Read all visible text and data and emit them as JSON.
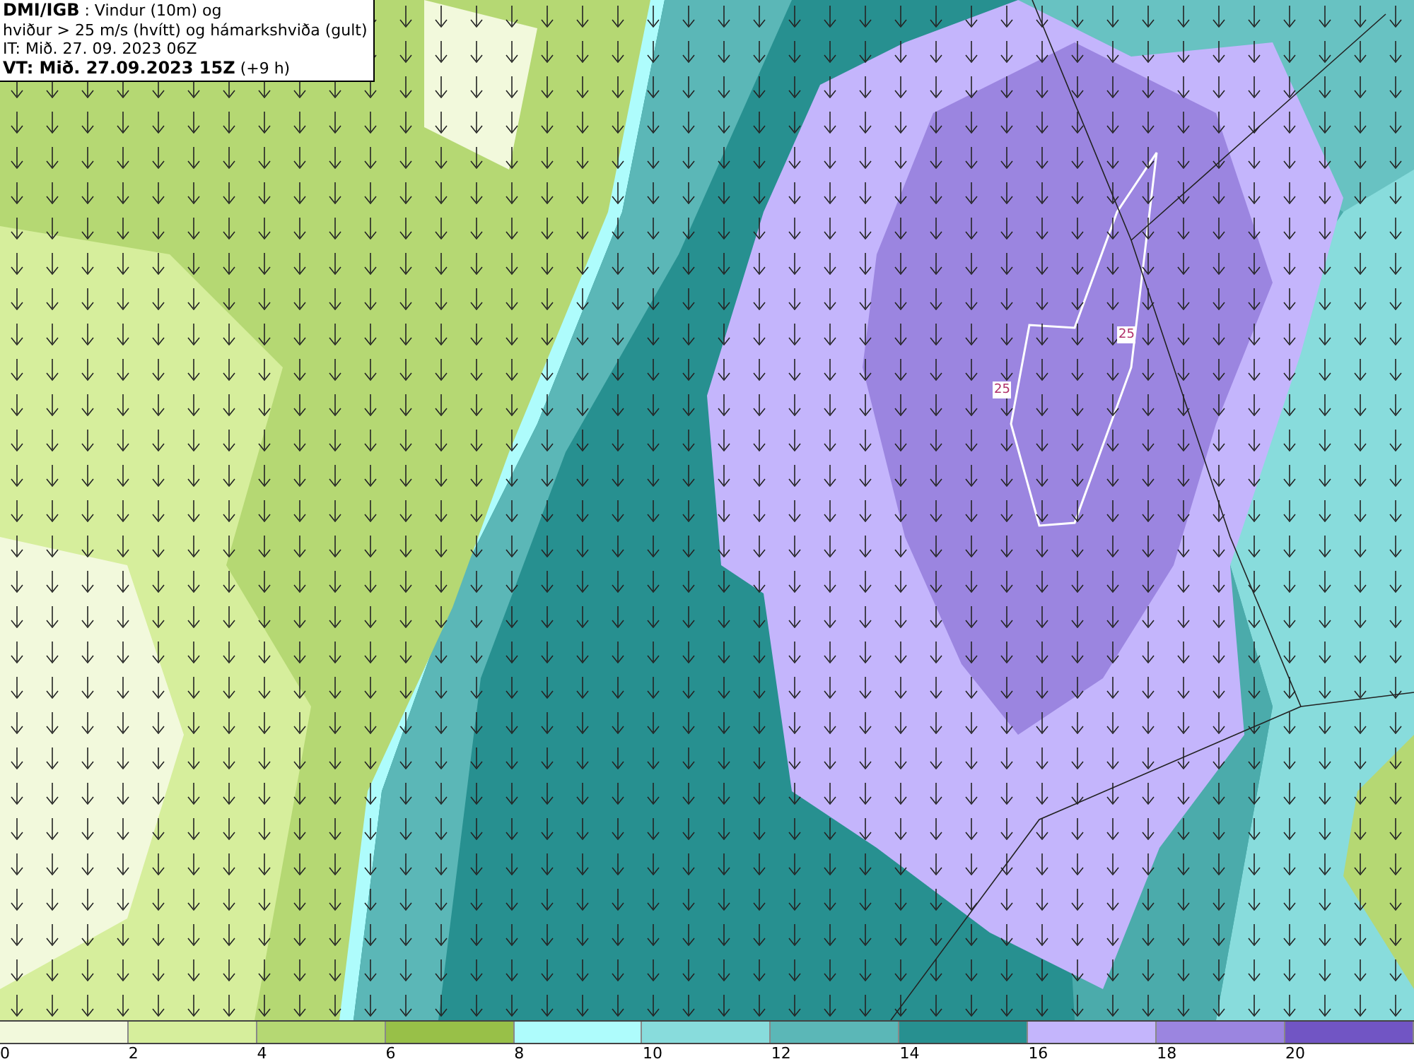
{
  "header": {
    "source": "DMI/IGB",
    "title_rest": " : Vindur (10m) og",
    "line_2": "hviður > 25 m/s (hvítt) og hámarkshviða (gult)",
    "issued": "IT: Mið. 27. 09. 2023 06Z",
    "valid": "VT: Mið. 27.09.2023 15Z",
    "valid_offset": " (+9 h)"
  },
  "map": {
    "contour_labels": [
      "25",
      "25"
    ]
  },
  "legend": {
    "bins": [
      {
        "color": "#f2f9dc"
      },
      {
        "color": "#d6ee9c"
      },
      {
        "color": "#b5d873"
      },
      {
        "color": "#98c048"
      },
      {
        "color": "#aefcfc"
      },
      {
        "color": "#88dcdc"
      },
      {
        "color": "#5bb7b7"
      },
      {
        "color": "#279090"
      },
      {
        "color": "#c4b5fc"
      },
      {
        "color": "#9b85e0"
      },
      {
        "color": "#7155c4"
      }
    ],
    "ticks": [
      "0",
      "2",
      "4",
      "6",
      "8",
      "10",
      "12",
      "14",
      "16",
      "18",
      "20"
    ]
  }
}
